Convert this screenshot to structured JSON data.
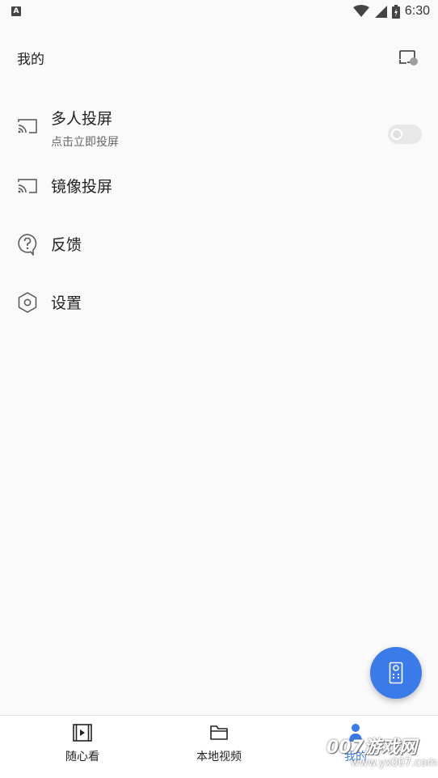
{
  "status_bar": {
    "left_badge": "A",
    "time": "6:30",
    "icons": [
      "wifi-icon",
      "signal-icon",
      "battery-icon"
    ]
  },
  "header": {
    "title": "我的",
    "action_icon": "cast-device-icon"
  },
  "menu": {
    "items": [
      {
        "icon": "cast-icon",
        "label": "多人投屏",
        "sublabel": "点击立即投屏",
        "toggle": false
      },
      {
        "icon": "cast-icon",
        "label": "镜像投屏"
      },
      {
        "icon": "help-bubble-icon",
        "label": "反馈"
      },
      {
        "icon": "hexagon-settings-icon",
        "label": "设置"
      }
    ]
  },
  "fab": {
    "icon": "remote-control-icon"
  },
  "bottom_nav": {
    "items": [
      {
        "icon": "video-play-icon",
        "label": "随心看",
        "active": false
      },
      {
        "icon": "folder-icon",
        "label": "本地视频",
        "active": false
      },
      {
        "icon": "person-icon",
        "label": "我的",
        "active": true
      }
    ]
  },
  "watermark": {
    "top": "007游戏网",
    "bottom": "www.yx007.com"
  },
  "colors": {
    "accent": "#3a7be9",
    "background": "#fafafa",
    "nav_bg": "#ffffff",
    "toggle_off": "#e8e8e8"
  }
}
